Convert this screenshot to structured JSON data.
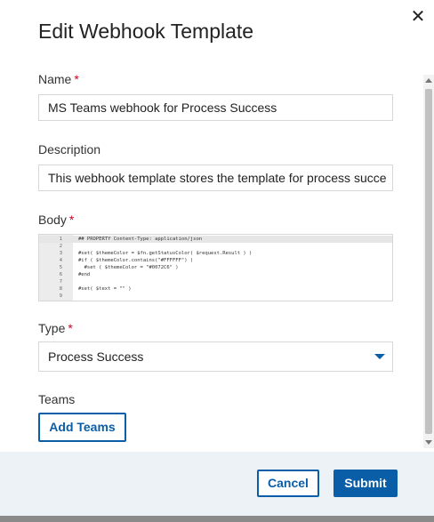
{
  "dialog": {
    "title": "Edit Webhook Template",
    "close_glyph": "✕"
  },
  "fields": {
    "name": {
      "label": "Name",
      "required_mark": "*",
      "value": "MS Teams webhook for Process Success"
    },
    "description": {
      "label": "Description",
      "value": "This webhook template stores the template for process succe"
    },
    "body": {
      "label": "Body",
      "required_mark": "*",
      "lines": [
        {
          "num": "1",
          "text": "## PROPERTY Content-Type: application/json"
        },
        {
          "num": "2",
          "text": ""
        },
        {
          "num": "3",
          "text": "#set( $themeColor = $fn.getStatusColor( $request.Result ) )"
        },
        {
          "num": "4",
          "text": "#if ( $themeColor.contains(\"#FFFFFF\") )"
        },
        {
          "num": "5",
          "text": "  #set ( $themeColor = \"#0072C6\" )"
        },
        {
          "num": "6",
          "text": "#end"
        },
        {
          "num": "7",
          "text": ""
        },
        {
          "num": "8",
          "text": "#set( $text = \"\" )"
        },
        {
          "num": "9",
          "text": ""
        }
      ]
    },
    "type": {
      "label": "Type",
      "required_mark": "*",
      "selected": "Process Success"
    },
    "teams": {
      "label": "Teams",
      "add_button": "Add Teams"
    }
  },
  "footer": {
    "cancel_label": "Cancel",
    "submit_label": "Submit"
  },
  "colors": {
    "accent": "#0a5ea8",
    "required": "#d0021b",
    "footer_bg": "#edf2f7"
  },
  "icons": {
    "close": "close-icon",
    "dropdown": "chevron-down-icon"
  }
}
